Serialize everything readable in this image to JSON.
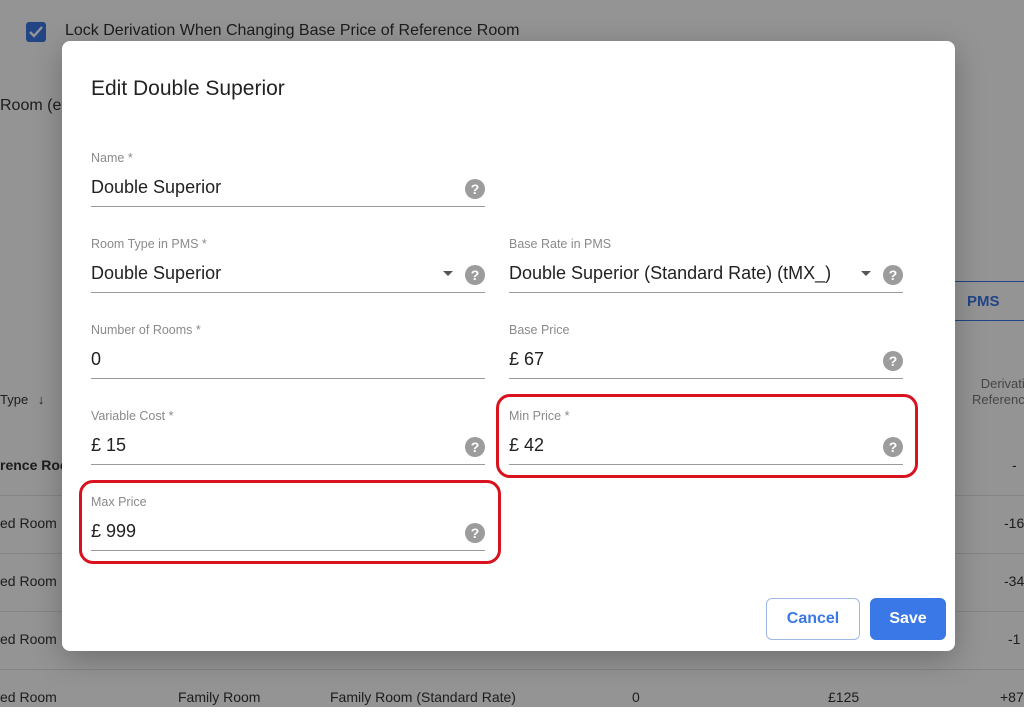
{
  "background": {
    "lock_derivation_label": "Lock Derivation When Changing Base Price of Reference Room",
    "room_label_partial": "Room (e",
    "pms_button_label": "PMS",
    "sort_header": "Type",
    "sort_arrow": "↓",
    "derivation_header_line1": "Derivatio",
    "derivation_header_line2": "Reference",
    "rows": [
      {
        "col1": "rence Room",
        "col6": "-"
      },
      {
        "col1": "ed Room",
        "col6": "-16"
      },
      {
        "col1": "ed Room",
        "col6": "-34"
      },
      {
        "col1": "ed Room",
        "col6": "-1"
      },
      {
        "col1": "ed Room",
        "col2": "Family Room",
        "col3": "Family Room (Standard Rate)",
        "col4": "0",
        "col5": "£125",
        "col6": "+87"
      }
    ]
  },
  "modal": {
    "title": "Edit Double Superior",
    "fields": {
      "name": {
        "label": "Name *",
        "value": "Double Superior"
      },
      "room_type": {
        "label": "Room Type in PMS *",
        "value": "Double Superior"
      },
      "base_rate": {
        "label": "Base Rate in PMS",
        "value": "Double Superior (Standard Rate) (tMX_)"
      },
      "num_rooms": {
        "label": "Number of Rooms *",
        "value": "0"
      },
      "base_price": {
        "label": "Base Price",
        "value": "£ 67"
      },
      "variable_cost": {
        "label": "Variable Cost *",
        "value": "£ 15"
      },
      "min_price": {
        "label": "Min Price *",
        "value": "£ 42"
      },
      "max_price": {
        "label": "Max Price",
        "value": "£ 999"
      }
    },
    "help_glyph": "?",
    "cancel_label": "Cancel",
    "save_label": "Save"
  },
  "colors": {
    "accent": "#3b78e7",
    "highlight": "#d8121e",
    "overlay": "rgba(0,0,0,0.42)"
  }
}
